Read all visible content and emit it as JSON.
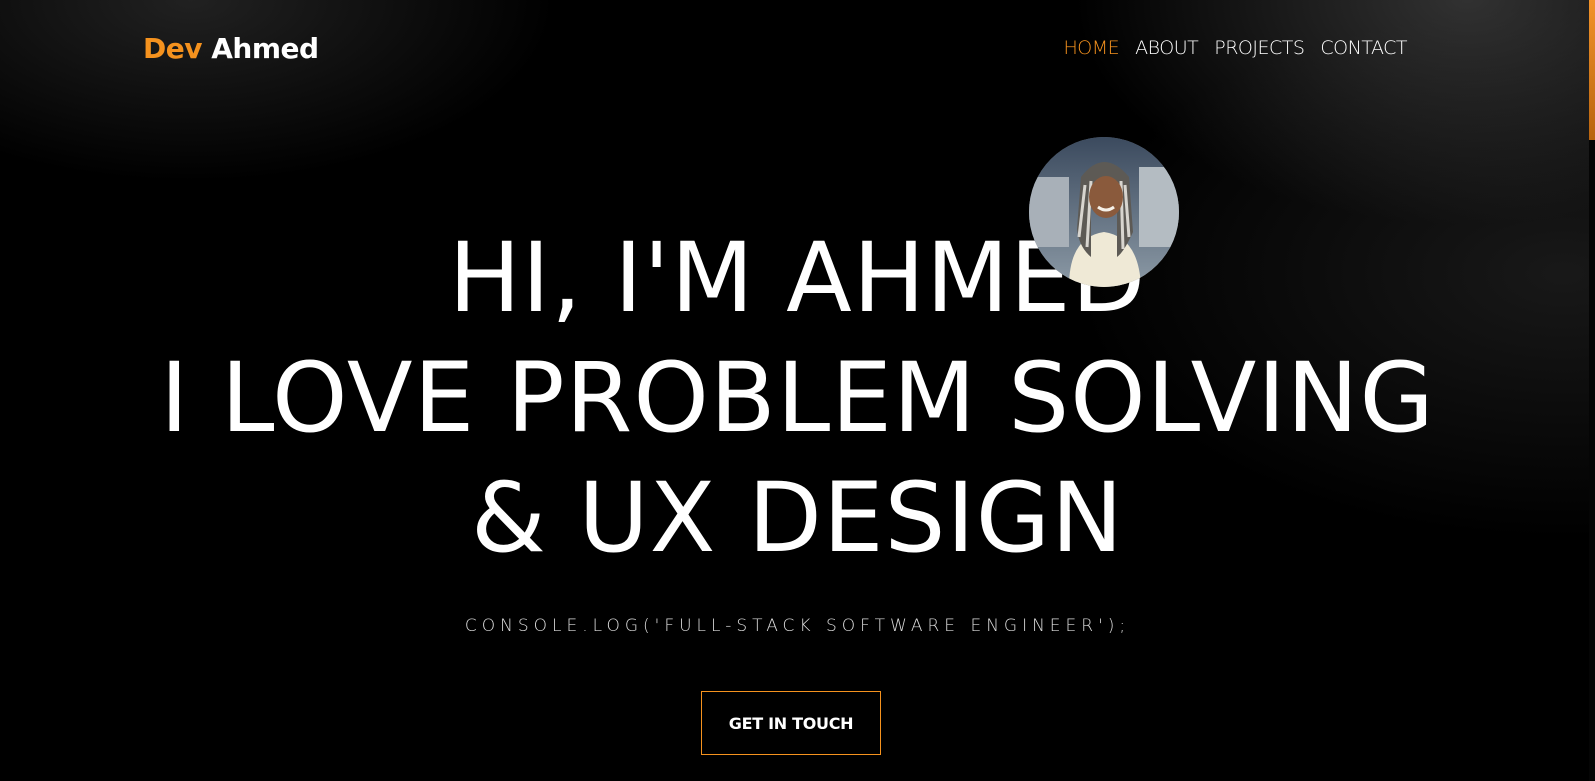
{
  "logo": {
    "accent": "Dev",
    "name": "Ahmed"
  },
  "nav": {
    "items": [
      {
        "label": "HOME",
        "active": true
      },
      {
        "label": "ABOUT",
        "active": false
      },
      {
        "label": "PROJECTS",
        "active": false
      },
      {
        "label": "CONTACT",
        "active": false
      }
    ]
  },
  "hero": {
    "line1": "HI, I'M AHMED",
    "line2": "I LOVE PROBLEM SOLVING",
    "line3": "& UX DESIGN",
    "subtitle": "CONSOLE.LOG('FULL-STACK SOFTWARE ENGINEER');",
    "cta_label": "GET IN TOUCH"
  },
  "colors": {
    "accent": "#f5921e",
    "background": "#000000",
    "text": "#ffffff"
  },
  "icons": {
    "avatar": "profile-photo"
  }
}
